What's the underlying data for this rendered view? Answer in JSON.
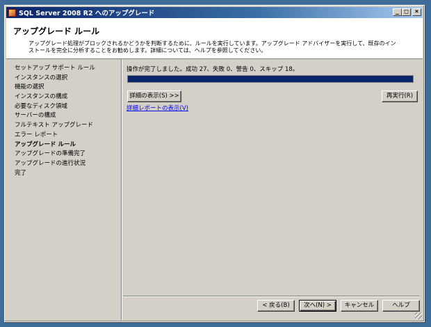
{
  "window": {
    "title": "SQL Server 2008 R2 へのアップグレード",
    "minimize": "_",
    "maximize": "□",
    "close": "×"
  },
  "header": {
    "title": "アップグレード ルール",
    "description": "アップグレード処理がブロックされるかどうかを判断するために、ルールを実行しています。アップグレード アドバイザーを実行して、既存のインストールを完全に分析することをお勧めします。詳細については、ヘルプを参照してください。"
  },
  "sidebar": {
    "items": [
      {
        "label": "セットアップ サポート ルール",
        "active": false
      },
      {
        "label": "インスタンスの選択",
        "active": false
      },
      {
        "label": "機能の選択",
        "active": false
      },
      {
        "label": "インスタンスの構成",
        "active": false
      },
      {
        "label": "必要なディスク領域",
        "active": false
      },
      {
        "label": "サーバーの構成",
        "active": false
      },
      {
        "label": "フルテキスト アップグレード",
        "active": false
      },
      {
        "label": "エラー レポート",
        "active": false
      },
      {
        "label": "アップグレード ルール",
        "active": true
      },
      {
        "label": "アップグレードの準備完了",
        "active": false
      },
      {
        "label": "アップグレードの進行状況",
        "active": false
      },
      {
        "label": "完了",
        "active": false
      }
    ]
  },
  "main": {
    "status": "操作が完了しました。成功 27、失敗 0、警告 0、スキップ 18。",
    "progress": 1.0,
    "show_details_label": "詳細の表示(S) >>",
    "rerun_label": "再実行(R)",
    "view_report_label": "詳細レポートの表示(V)"
  },
  "footer": {
    "back_label": "< 戻る(B)",
    "next_label": "次へ(N) >",
    "cancel_label": "キャンセル",
    "help_label": "ヘルプ"
  },
  "colors": {
    "titlebar": "#0a246a",
    "progress": "#0a246a",
    "link": "#0000ee",
    "background": "#3f6d9a"
  }
}
